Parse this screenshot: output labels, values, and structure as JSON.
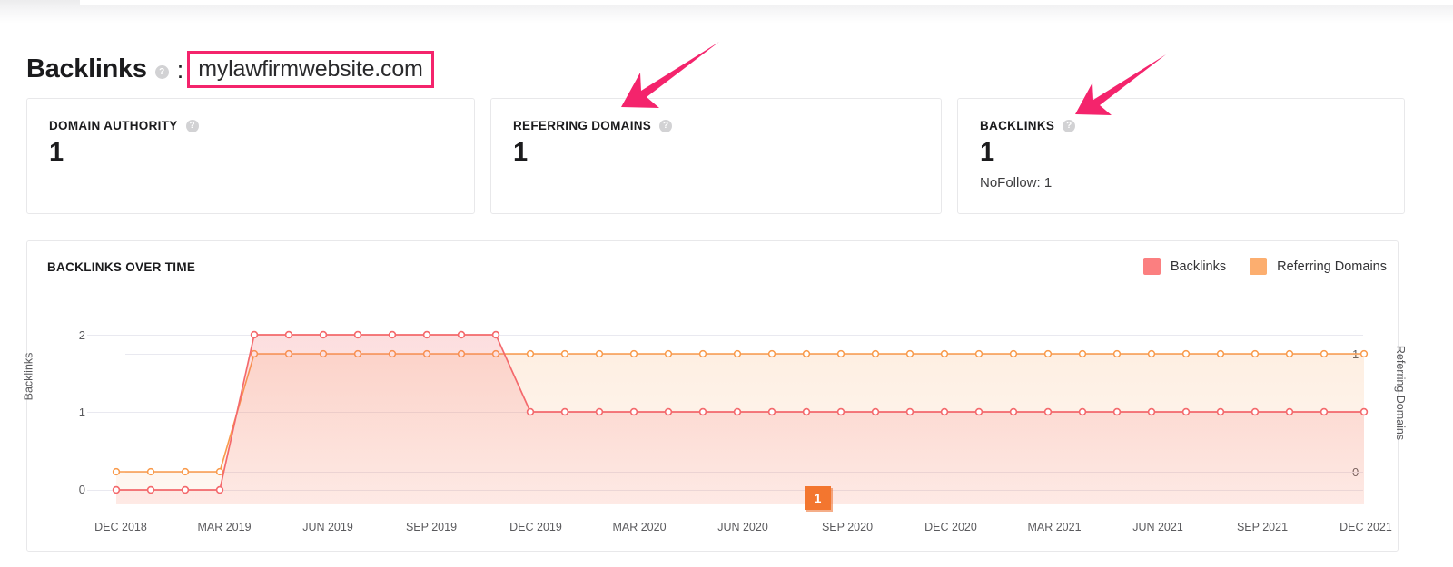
{
  "header": {
    "title": "Backlinks",
    "separator": ":",
    "domain": "mylawfirmwebsite.com",
    "help_icon": "?"
  },
  "cards": [
    {
      "label": "DOMAIN AUTHORITY",
      "value": "1",
      "sub": "",
      "help_icon": "?"
    },
    {
      "label": "REFERRING DOMAINS",
      "value": "1",
      "sub": "",
      "help_icon": "?"
    },
    {
      "label": "BACKLINKS",
      "value": "1",
      "sub": "NoFollow: 1",
      "help_icon": "?"
    }
  ],
  "chart_panel": {
    "title": "BACKLINKS OVER TIME",
    "legend": [
      {
        "label": "Backlinks",
        "color": "#FB7F80"
      },
      {
        "label": "Referring Domains",
        "color": "#FCAE6F"
      }
    ],
    "badge": {
      "label": "1",
      "color": "#F3762F"
    }
  },
  "colors": {
    "accent_pink": "#F4246C",
    "backlinks": "#F4696C",
    "referring_domains": "#F99A4B",
    "card_border": "#E8E8EA",
    "grid": "#E9E9F0"
  },
  "chart_data": {
    "type": "line",
    "title": "BACKLINKS OVER TIME",
    "xlabel": "",
    "ylabel": "Backlinks",
    "y2label": "Referring Domains",
    "ylim": [
      0,
      2
    ],
    "y2lim": [
      0,
      1
    ],
    "yticks": [
      0,
      1,
      2
    ],
    "y2ticks": [
      0,
      1
    ],
    "grid": true,
    "legend_position": "top-right",
    "x_tick_labels": [
      "DEC 2018",
      "MAR 2019",
      "JUN 2019",
      "SEP 2019",
      "DEC 2019",
      "MAR 2020",
      "JUN 2020",
      "SEP 2020",
      "DEC 2020",
      "MAR 2021",
      "JUN 2021",
      "SEP 2021",
      "DEC 2021"
    ],
    "x": [
      "DEC 2018",
      "JAN 2019",
      "FEB 2019",
      "MAR 2019",
      "APR 2019",
      "MAY 2019",
      "JUN 2019",
      "JUL 2019",
      "AUG 2019",
      "SEP 2019",
      "OCT 2019",
      "NOV 2019",
      "DEC 2019",
      "JAN 2020",
      "FEB 2020",
      "MAR 2020",
      "APR 2020",
      "MAY 2020",
      "JUN 2020",
      "JUL 2020",
      "AUG 2020",
      "SEP 2020",
      "OCT 2020",
      "NOV 2020",
      "DEC 2020",
      "JAN 2021",
      "FEB 2021",
      "MAR 2021",
      "APR 2021",
      "MAY 2021",
      "JUN 2021",
      "JUL 2021",
      "AUG 2021",
      "SEP 2021",
      "OCT 2021",
      "NOV 2021",
      "DEC 2021"
    ],
    "series": [
      {
        "name": "Backlinks",
        "axis": "left",
        "color": "#F4696C",
        "values": [
          0,
          0,
          0,
          0,
          2,
          2,
          2,
          2,
          2,
          2,
          2,
          2,
          1,
          1,
          1,
          1,
          1,
          1,
          1,
          1,
          1,
          1,
          1,
          1,
          1,
          1,
          1,
          1,
          1,
          1,
          1,
          1,
          1,
          1,
          1,
          1,
          1
        ]
      },
      {
        "name": "Referring Domains",
        "axis": "right",
        "color": "#F99A4B",
        "values": [
          0,
          0,
          0,
          0,
          1,
          1,
          1,
          1,
          1,
          1,
          1,
          1,
          1,
          1,
          1,
          1,
          1,
          1,
          1,
          1,
          1,
          1,
          1,
          1,
          1,
          1,
          1,
          1,
          1,
          1,
          1,
          1,
          1,
          1,
          1,
          1,
          1
        ]
      }
    ],
    "annotation_badge": {
      "label": "1",
      "at_x": "SEP 2020"
    }
  },
  "annotations": {
    "arrows": [
      {
        "name": "arrow-referring-domains",
        "color": "#F4246C"
      },
      {
        "name": "arrow-backlinks",
        "color": "#F4246C"
      }
    ]
  }
}
